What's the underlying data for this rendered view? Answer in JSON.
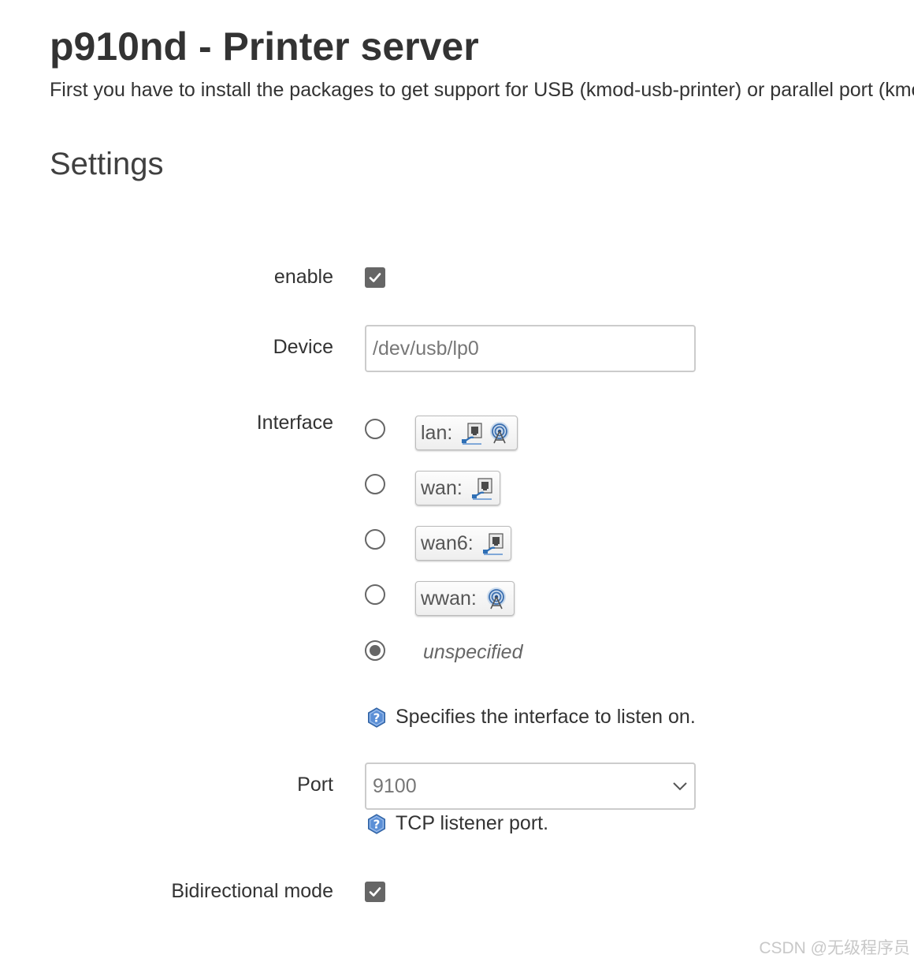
{
  "page": {
    "title": "p910nd - Printer server",
    "description": "First you have to install the packages to get support for USB (kmod-usb-printer) or parallel port (kmod-lp).",
    "section_title": "Settings"
  },
  "form": {
    "enable": {
      "label": "enable",
      "checked": true
    },
    "device": {
      "label": "Device",
      "value": "",
      "placeholder": "/dev/usb/lp0"
    },
    "interface": {
      "label": "Interface",
      "options": [
        {
          "name": "lan:",
          "icons": [
            "ethernet-port-icon",
            "wireless-icon"
          ],
          "selected": false
        },
        {
          "name": "wan:",
          "icons": [
            "ethernet-port-icon"
          ],
          "selected": false
        },
        {
          "name": "wan6:",
          "icons": [
            "ethernet-port-icon"
          ],
          "selected": false
        },
        {
          "name": "wwan:",
          "icons": [
            "wireless-icon"
          ],
          "selected": false
        }
      ],
      "unspecified": {
        "label": "unspecified",
        "selected": true
      },
      "help": "Specifies the interface to listen on."
    },
    "port": {
      "label": "Port",
      "value": "9100",
      "help": "TCP listener port."
    },
    "bidirectional": {
      "label": "Bidirectional mode",
      "checked": true
    }
  },
  "colors": {
    "text": "#333333",
    "control": "#666666",
    "border": "#cccccc",
    "help_icon": "#5b8fd6"
  },
  "watermark": "CSDN @无级程序员"
}
